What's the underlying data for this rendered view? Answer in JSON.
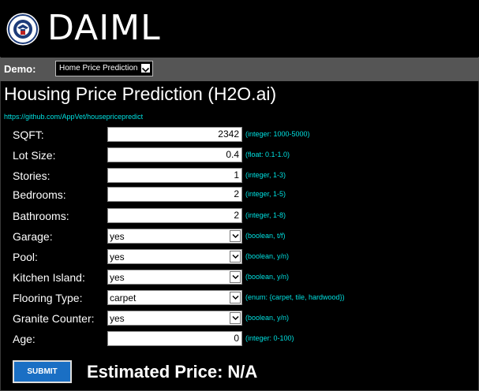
{
  "app": {
    "title": "DAIML"
  },
  "demo_bar": {
    "label": "Demo:",
    "selected": "Home Price Prediction"
  },
  "page": {
    "title": "Housing Price Prediction (H2O.ai)",
    "link": "https://github.com/AppVet/housepricepredict"
  },
  "fields": {
    "sqft": {
      "label": "SQFT:",
      "value": "2342",
      "hint": "(integer: 1000-5000)"
    },
    "lot": {
      "label": "Lot Size:",
      "value": "0.4",
      "hint": "(float: 0.1-1.0)"
    },
    "stories": {
      "label": "Stories:",
      "value": "1",
      "hint": "(integer, 1-3)"
    },
    "bedrooms": {
      "label": "Bedrooms:",
      "value": "2",
      "hint": "(integer, 1-5)"
    },
    "bathrooms": {
      "label": "Bathrooms:",
      "value": "2",
      "hint": "(integer, 1-8)"
    },
    "garage": {
      "label": "Garage:",
      "value": "yes",
      "hint": "(boolean, t/f)"
    },
    "pool": {
      "label": "Pool:",
      "value": "yes",
      "hint": "(boolean, y/n)"
    },
    "kitchen": {
      "label": "Kitchen Island:",
      "value": "yes",
      "hint": "(boolean, y/n)"
    },
    "flooring": {
      "label": "Flooring Type:",
      "value": "carpet",
      "hint": "(enum: {carpet, tile, hardwood})"
    },
    "granite": {
      "label": "Granite Counter:",
      "value": "yes",
      "hint": "(boolean, y/n)"
    },
    "age": {
      "label": "Age:",
      "value": "0",
      "hint": "(integer: 0-100)"
    }
  },
  "submit_label": "SUBMIT",
  "result": {
    "label": "Estimated Price:",
    "value": "N/A"
  },
  "colors": {
    "accent": "#1a6fc4",
    "hint": "#00e0e0",
    "bar": "#555555"
  },
  "icons": {
    "seal": "dhs-seal-icon",
    "dropdown": "chevron-down-icon"
  }
}
